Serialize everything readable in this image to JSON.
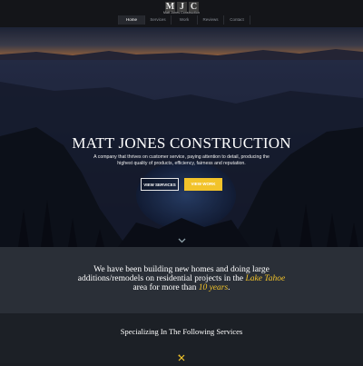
{
  "header": {
    "logo_letters": [
      "M",
      "J",
      "C"
    ],
    "logo_subtitle": "Matt Jones Construction",
    "nav": [
      {
        "label": "Home",
        "active": true
      },
      {
        "label": "Services",
        "active": false
      },
      {
        "label": "Work",
        "active": false
      },
      {
        "label": "Reviews",
        "active": false
      },
      {
        "label": "Contact",
        "active": false
      }
    ]
  },
  "hero": {
    "title": "MATT JONES CONSTRUCTION",
    "text": "A company that thrives on customer service, paying attention to detail, producing the highest quality of products, efficiency, fairness and reputation.",
    "btn_services": "VIEW SERVICES",
    "btn_work": "VIEW WORK"
  },
  "intro": {
    "before": "We have been building new homes and doing large additions/remodels on residential projects in the ",
    "place": "Lake Tahoe",
    "middle": " area for more than ",
    "years": "10 years",
    "end": "."
  },
  "services": {
    "title": "Specializing In The Following Services"
  },
  "colors": {
    "accent": "#f2c32a",
    "header_bg": "#141519",
    "intro_bg": "#2a2f37",
    "services_bg": "#1c2026"
  },
  "icons": [
    "chevron-down-icon",
    "tools-icon"
  ]
}
